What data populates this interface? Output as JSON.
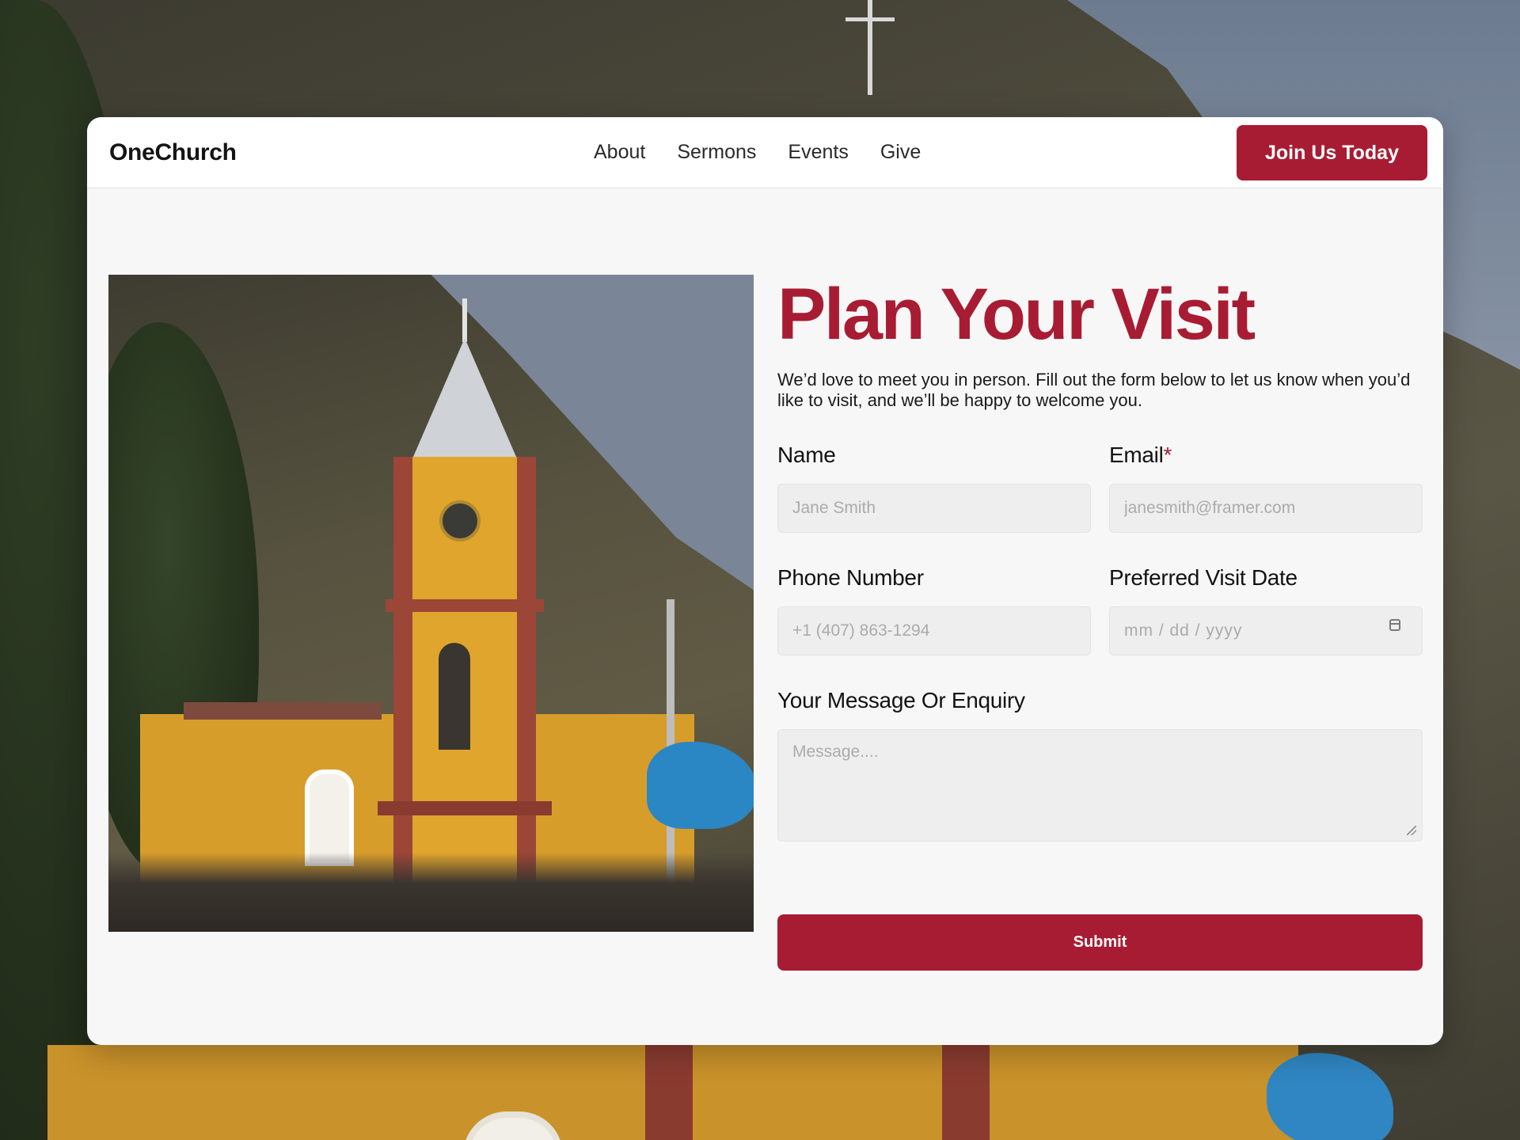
{
  "brand": "OneChurch",
  "nav": {
    "links": [
      "About",
      "Sermons",
      "Events",
      "Give"
    ],
    "cta_label": "Join Us Today"
  },
  "hero": {
    "title": "Plan Your Visit",
    "intro": "We’d love to meet you in person. Fill out the form below to let us know when you’d like to visit, and we’ll be happy to welcome you."
  },
  "form": {
    "name": {
      "label": "Name",
      "placeholder": "Jane Smith",
      "value": ""
    },
    "email": {
      "label": "Email",
      "required_mark": "*",
      "placeholder": "janesmith@framer.com",
      "value": ""
    },
    "phone": {
      "label": "Phone Number",
      "placeholder": "+1 (407) 863-1294",
      "value": ""
    },
    "date": {
      "label": "Preferred Visit Date",
      "placeholder": "mm / dd / yyyy",
      "icon": "calendar-icon"
    },
    "message": {
      "label": "Your Message Or Enquiry",
      "placeholder": "Message....",
      "value": ""
    },
    "submit_label": "Submit"
  },
  "colors": {
    "accent": "#a81c33",
    "card_background": "#f7f7f7",
    "input_background": "#eeeeee"
  }
}
